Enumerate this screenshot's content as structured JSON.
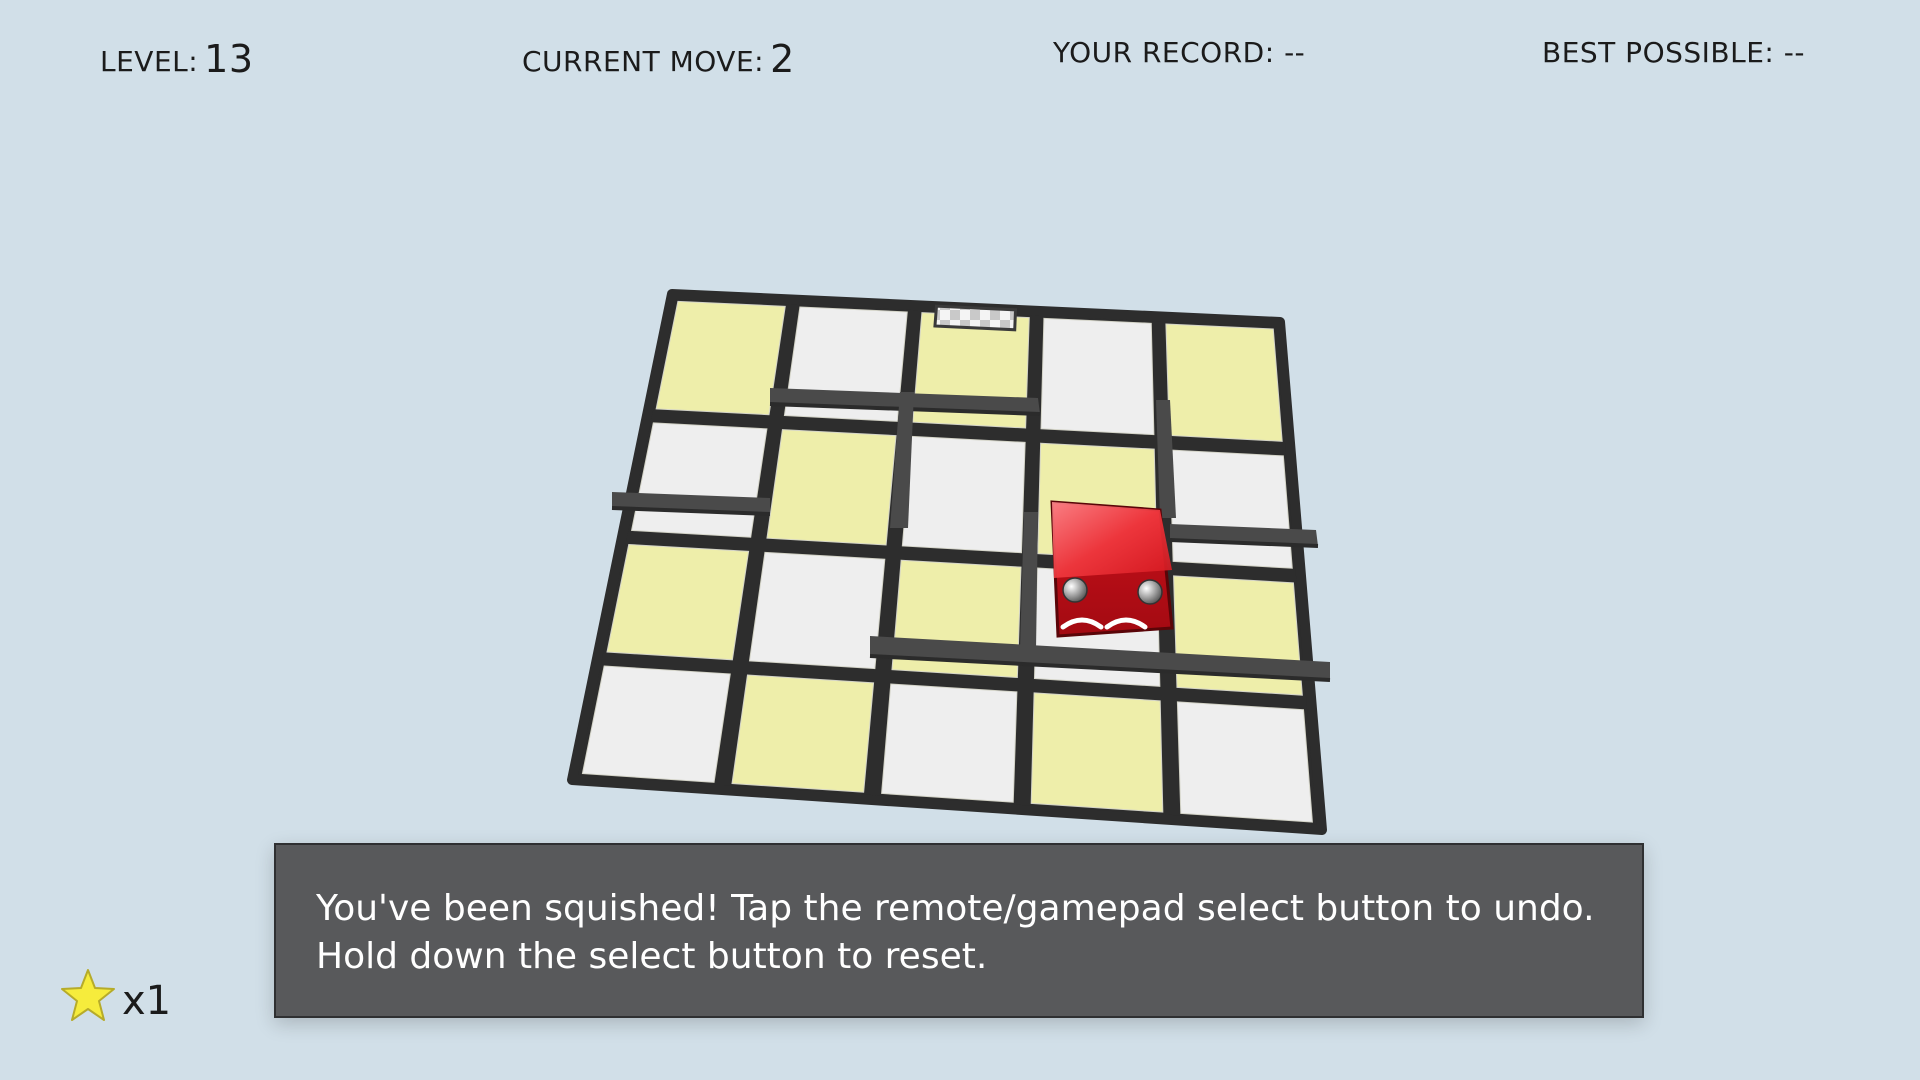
{
  "hud": {
    "level_label": "LEVEL:",
    "level_value": "13",
    "move_label": "CURRENT MOVE:",
    "move_value": "2",
    "record_label": "YOUR RECORD:",
    "record_value": "--",
    "best_label": "BEST POSSIBLE:",
    "best_value": "--"
  },
  "message": {
    "line1": "You've been squished!  Tap the remote/gamepad select button to undo.",
    "line2": "Hold down the select button to reset."
  },
  "stars": {
    "count": "x1"
  },
  "board": {
    "columns": 5,
    "rows": 4,
    "tile_colors": [
      [
        "yellow",
        "white",
        "goal",
        "white",
        "yellow"
      ],
      [
        "white",
        "yellow",
        "white",
        "yellow",
        "white"
      ],
      [
        "yellow",
        "white",
        "yellow",
        "white",
        "yellow"
      ],
      [
        "white",
        "yellow",
        "white",
        "yellow",
        "white"
      ]
    ],
    "goal_tile": {
      "row": 0,
      "col": 2
    },
    "player": {
      "row": 2,
      "col": 3,
      "state": "squished"
    },
    "colors": {
      "background": "#d1dfe8",
      "tile_yellow": "#eeeeaa",
      "tile_white": "#eeeeee",
      "wall": "#4a4a4a",
      "player_red": "#d8131b",
      "message_bg": "#58595b",
      "star": "#f6ec3c"
    }
  }
}
